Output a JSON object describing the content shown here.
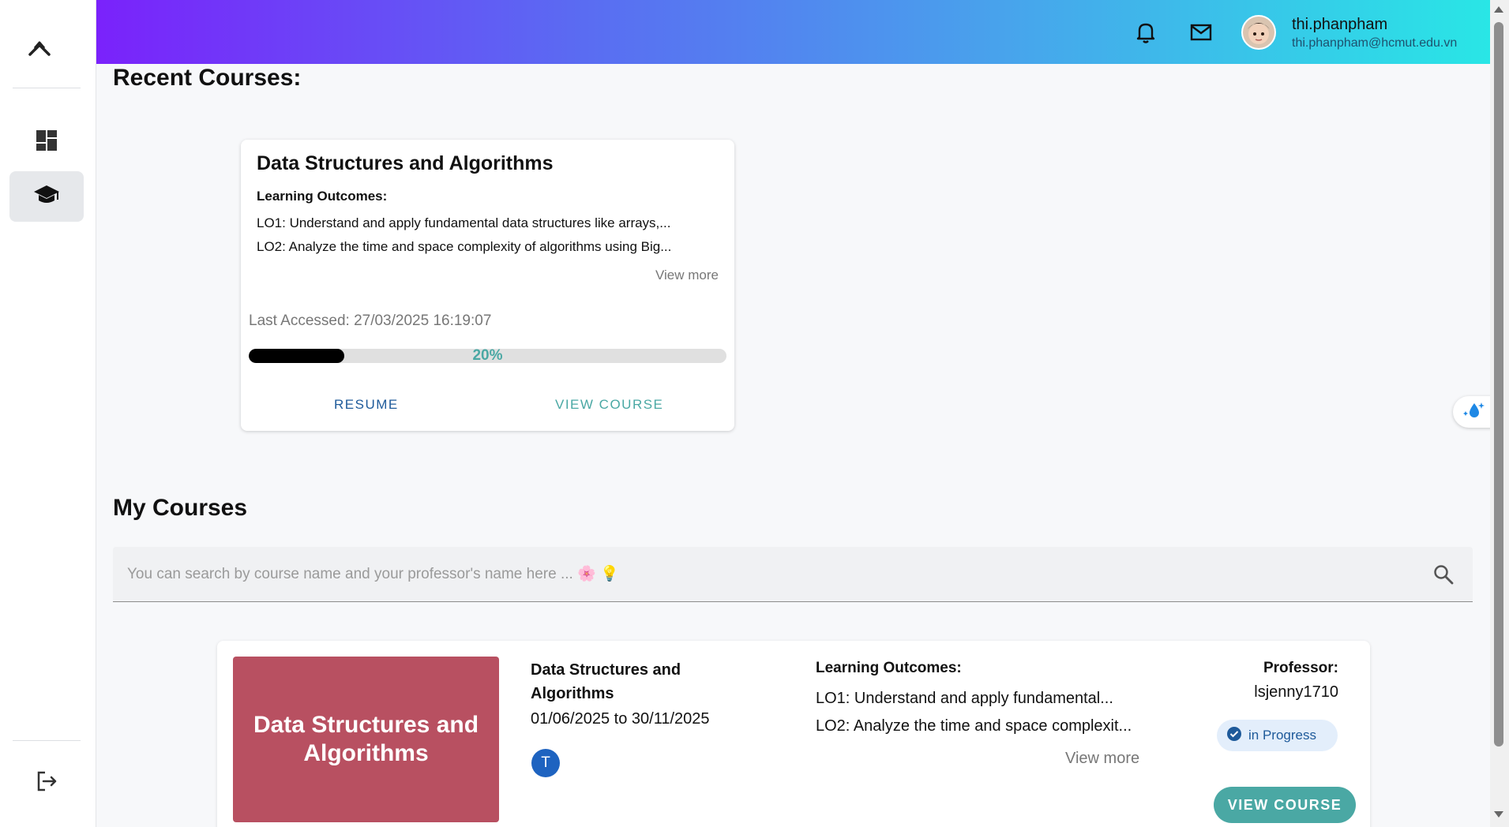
{
  "header": {
    "user_name": "thi.phanpham",
    "user_email": "thi.phanpham@hcmut.edu.vn",
    "icons": [
      "bell-icon",
      "mail-icon"
    ]
  },
  "sidebar": {
    "items": [
      {
        "icon": "dashboard-icon",
        "active": false
      },
      {
        "icon": "graduation-cap-icon",
        "active": true
      }
    ],
    "logout_icon": "logout-icon"
  },
  "recent": {
    "title": "Recent Courses:",
    "card": {
      "course_title": "Data Structures and Algorithms",
      "lo_label": "Learning Outcomes:",
      "lo1": "LO1: Understand and apply fundamental data structures like arrays,...",
      "lo2": "LO2: Analyze the time and space complexity of algorithms using Big...",
      "view_more": "View more",
      "last_accessed": "Last Accessed: 27/03/2025 16:19:07",
      "progress_value": 0.2,
      "progress_text": "20%",
      "resume_label": "RESUME",
      "view_course_label": "VIEW COURSE"
    }
  },
  "my_courses": {
    "title": "My Courses",
    "search_placeholder": "You can search by course name and your professor's name here ... 🌸 💡",
    "courses": [
      {
        "thumb_title": "Data Structures and Algorithms",
        "name": "Data Structures and Algorithms",
        "dates": "01/06/2025 to 30/11/2025",
        "avatar_letter": "T",
        "lo_label": "Learning Outcomes:",
        "lo1": "LO1: Understand and apply fundamental...",
        "lo2": "LO2: Analyze the time and space complexit...",
        "view_more": "View more",
        "professor_label": "Professor:",
        "professor": "lsjenny1710",
        "status": "in Progress",
        "view_course_label": "VIEW COURSE"
      }
    ]
  },
  "colors": {
    "header_gradient": [
      "#7a22fb",
      "#48a3ec",
      "#29e6e6"
    ],
    "accent_teal": "#4aa8a4",
    "course_thumb": "#b85061",
    "status_blue": "#1e5a9a"
  }
}
